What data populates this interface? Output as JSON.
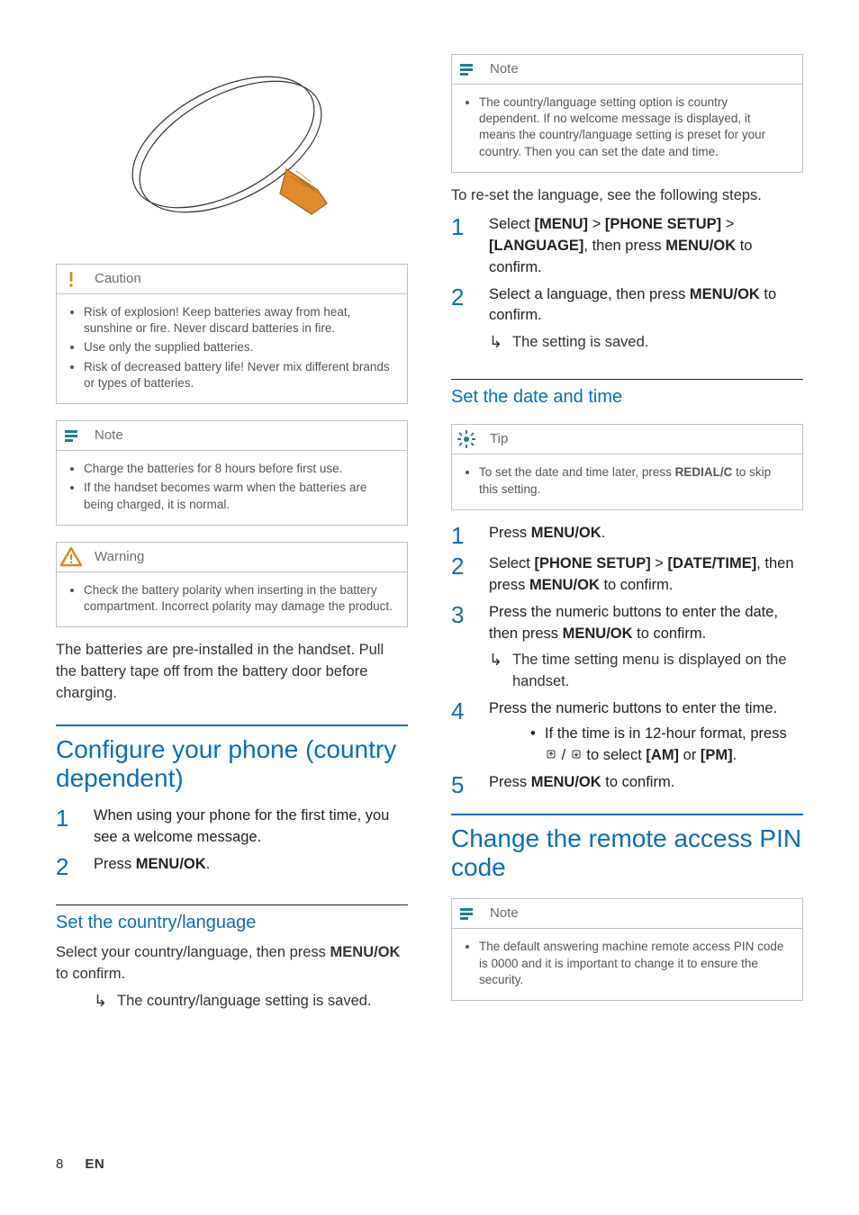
{
  "callouts": {
    "caution": {
      "label": "Caution",
      "items": [
        "Risk of explosion! Keep batteries away from heat, sunshine or fire. Never discard batteries in fire.",
        "Use only the supplied batteries.",
        "Risk of decreased battery life! Never mix different brands or types of batteries."
      ]
    },
    "note1": {
      "label": "Note",
      "items": [
        "Charge the batteries for 8 hours before first use.",
        "If the handset becomes warm when the batteries are being charged, it is normal."
      ]
    },
    "warning": {
      "label": "Warning",
      "items": [
        "Check the battery polarity when inserting in the battery compartment. Incorrect polarity may damage the product."
      ]
    },
    "note2": {
      "label": "Note",
      "items": [
        "The country/language setting option is country dependent. If no welcome message is displayed, it means the country/language setting is preset for your country. Then you can set the date and time."
      ]
    },
    "tip1": {
      "label": "Tip",
      "items": []
    },
    "note3": {
      "label": "Note",
      "items": [
        "The default answering machine remote access PIN code is 0000 and it is important to change it to ensure the security."
      ]
    }
  },
  "left": {
    "preinstalled": "The batteries are pre-installed in the handset. Pull the battery tape off from the battery door before charging.",
    "h1": "Configure your phone (country dependent)",
    "steps1": {
      "s1": "When using your phone for the first time, you see a welcome message.",
      "s2_a": "Press ",
      "s2_b": "MENU/OK",
      "s2_c": "."
    },
    "h2": "Set the country/language",
    "para_a": "Select your country/language, then press ",
    "para_b": "MENU/OK",
    "para_c": " to confirm.",
    "saved": "The country/language setting is saved."
  },
  "right": {
    "rereset": "To re-set the language, see the following steps.",
    "lang_steps": {
      "s1_a": "Select ",
      "s1_b": "[MENU]",
      "s1_c": " > ",
      "s1_d": "[PHONE SETUP]",
      "s1_e": " > ",
      "s1_f": "[LANGUAGE]",
      "s1_g": ", then press ",
      "s1_h": "MENU/OK",
      "s1_i": " to confirm.",
      "s2_a": "Select a language, then press ",
      "s2_b": "MENU/OK",
      "s2_c": " to confirm.",
      "saved": "The setting is saved."
    },
    "h2_date": "Set the date and time",
    "tip_a": "To set the date and time later, press ",
    "tip_b": "REDIAL/C",
    "tip_c": " to skip this setting.",
    "date_steps": {
      "s1_a": "Press ",
      "s1_b": "MENU/OK",
      "s1_c": ".",
      "s2_a": "Select ",
      "s2_b": "[PHONE SETUP]",
      "s2_c": " > ",
      "s2_d": "[DATE/TIME]",
      "s2_e": ", then press ",
      "s2_f": "MENU/OK",
      "s2_g": " to confirm.",
      "s3_a": "Press the numeric buttons to enter the date, then press ",
      "s3_b": "MENU/OK",
      "s3_c": " to confirm.",
      "s3_result": "The time setting menu is displayed on the handset.",
      "s4": "Press the numeric buttons to enter the time.",
      "s4_sub_a": "If the time is in 12-hour format, press ",
      "s4_sub_b": " / ",
      "s4_sub_c": " to select ",
      "s4_sub_d": "[AM]",
      "s4_sub_e": " or ",
      "s4_sub_f": "[PM]",
      "s4_sub_g": ".",
      "s5_a": "Press ",
      "s5_b": "MENU/OK",
      "s5_c": " to confirm."
    },
    "h1_pin": "Change the remote access PIN code"
  },
  "footer": {
    "page": "8",
    "lang": "EN"
  }
}
